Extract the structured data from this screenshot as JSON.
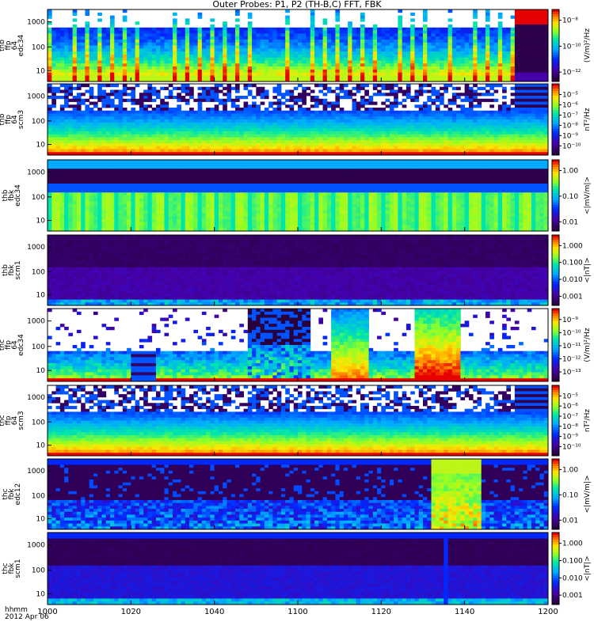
{
  "title": "Outer Probes: P1, P2 (TH-B,C) FFT, FBK",
  "footer": {
    "time_label": "hhmm",
    "date_label": "2012 Apr 06"
  },
  "chart_data": {
    "type": "heatmap",
    "x_axis": {
      "ticks": [
        "1000",
        "1020",
        "1040",
        "1100",
        "1120",
        "1140",
        "1200"
      ]
    },
    "panels": [
      {
        "label": [
          "thb",
          "ffp",
          "64",
          "edc34"
        ],
        "y_ticks": [
          "10",
          "100",
          "1000"
        ],
        "cbar_unit": "(V/m)²/Hz",
        "cbar_ticks": [
          "10⁻⁸",
          "10⁻¹⁰",
          "10⁻¹²"
        ],
        "style": "spiky",
        "seed": 3
      },
      {
        "label": [
          "thb",
          "ffp",
          "64",
          "scm3"
        ],
        "y_ticks": [
          "10",
          "100",
          "1000"
        ],
        "cbar_unit": "nT²/Hz",
        "cbar_ticks": [
          "10⁻⁵",
          "10⁻⁶",
          "10⁻⁷",
          "10⁻⁸",
          "10⁻⁹",
          "10⁻¹⁰"
        ],
        "style": "bands",
        "seed": 7
      },
      {
        "label": [
          "thb",
          "fbk",
          "edc34"
        ],
        "y_ticks": [
          "10",
          "100",
          "1000"
        ],
        "cbar_unit": "<|mV/m|>",
        "cbar_ticks": [
          "1.00",
          "0.10",
          "0.01"
        ],
        "style": "fbk_e",
        "seed": 11
      },
      {
        "label": [
          "thb",
          "fbk",
          "scm1"
        ],
        "y_ticks": [
          "10",
          "100",
          "1000"
        ],
        "cbar_unit": "<|nT|>",
        "cbar_ticks": [
          "1.000",
          "0.100",
          "0.010",
          "0.001"
        ],
        "style": "fbk_b",
        "seed": 13
      },
      {
        "label": [
          "thc",
          "ffp",
          "64",
          "edc34"
        ],
        "y_ticks": [
          "10",
          "100",
          "1000"
        ],
        "cbar_unit": "(V/m)²/Hz",
        "cbar_ticks": [
          "10⁻⁹",
          "10⁻¹⁰",
          "10⁻¹¹",
          "10⁻¹²",
          "10⁻¹³"
        ],
        "style": "burst",
        "seed": 17
      },
      {
        "label": [
          "thc",
          "ffp",
          "64",
          "scm3"
        ],
        "y_ticks": [
          "10",
          "100",
          "1000"
        ],
        "cbar_unit": "nT²/Hz",
        "cbar_ticks": [
          "10⁻⁵",
          "10⁻⁶",
          "10⁻⁷",
          "10⁻⁸",
          "10⁻⁹",
          "10⁻¹⁰"
        ],
        "style": "bands",
        "seed": 19
      },
      {
        "label": [
          "thc",
          "fbk",
          "edc12"
        ],
        "y_ticks": [
          "10",
          "100",
          "1000"
        ],
        "cbar_unit": "<|mV/m|>",
        "cbar_ticks": [
          "1.00",
          "0.10",
          "0.01"
        ],
        "style": "fbk_c",
        "seed": 23
      },
      {
        "label": [
          "thc",
          "fbk",
          "scm1"
        ],
        "y_ticks": [
          "10",
          "100",
          "1000"
        ],
        "cbar_unit": "<|nT|>",
        "cbar_ticks": [
          "1.000",
          "0.100",
          "0.010",
          "0.001"
        ],
        "style": "fbk_b2",
        "seed": 29
      }
    ]
  }
}
